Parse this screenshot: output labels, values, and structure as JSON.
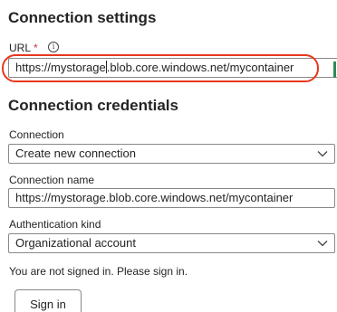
{
  "connection_settings": {
    "title": "Connection settings",
    "url_label": "URL",
    "url_required_marker": "*",
    "info_icon": "info-icon",
    "url_value_part1": "https://mystorage",
    "url_value_part2": ".blob.core.windows.net/mycontainer"
  },
  "connection_credentials": {
    "title": "Connection credentials",
    "connection_label": "Connection",
    "connection_selected": "Create new connection",
    "connection_name_label": "Connection name",
    "connection_name_value": "https://mystorage.blob.core.windows.net/mycontainer",
    "auth_kind_label": "Authentication kind",
    "auth_kind_selected": "Organizational account",
    "signin_message": "You are not signed in. Please sign in.",
    "signin_button": "Sign in"
  },
  "colors": {
    "annotation": "#e8371c",
    "required": "#c4314b",
    "accent_edge": "#2e8b57"
  }
}
